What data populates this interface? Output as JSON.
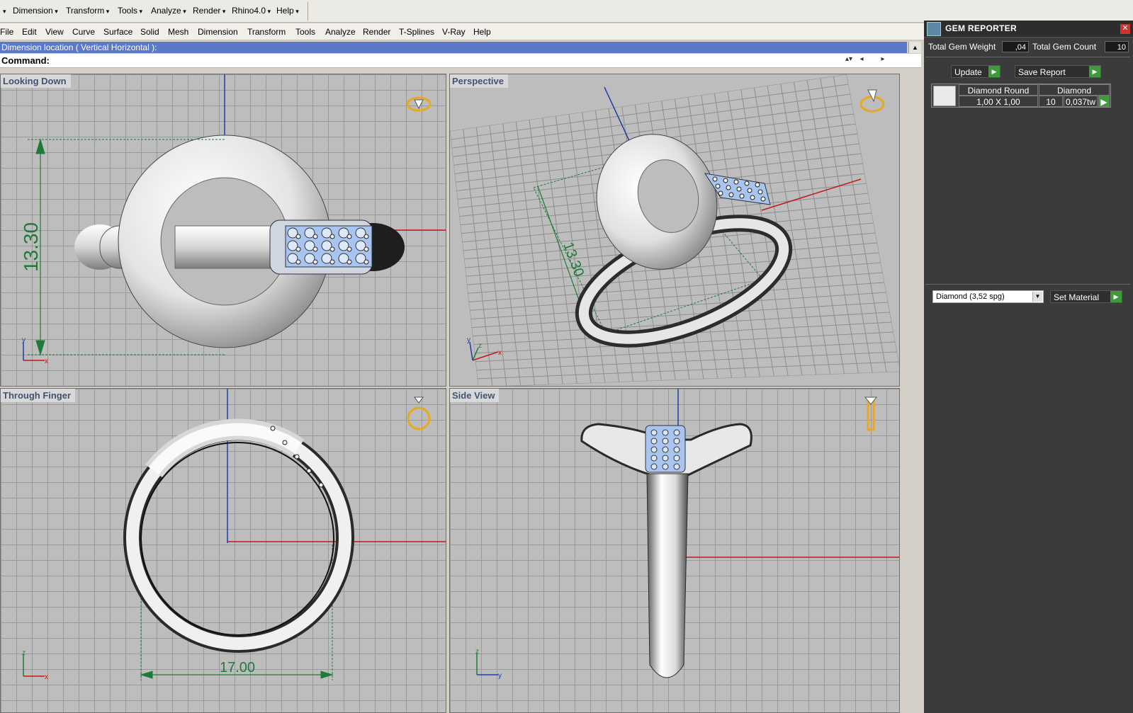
{
  "topbar": {
    "items": [
      "Dimension",
      "Transform",
      "Tools",
      "Analyze",
      "Render",
      "Rhino4.0",
      "Help"
    ]
  },
  "menubar": {
    "items": [
      "File",
      "Edit",
      "View",
      "Curve",
      "Surface",
      "Solid",
      "Mesh",
      "Dimension",
      "Transform",
      "Tools",
      "Analyze",
      "Render",
      "T-Splines",
      "V-Ray",
      "Help"
    ]
  },
  "command_area": {
    "prompt": "Dimension location ( Vertical  Horizontal ):",
    "command_label": "Command:"
  },
  "viewports": {
    "top_left": {
      "title": "Looking Down",
      "dimension": "13.30"
    },
    "top_right": {
      "title": "Perspective",
      "dimension": "13.30"
    },
    "bottom_left": {
      "title": "Through Finger",
      "dimension": "17.00"
    },
    "bottom_right": {
      "title": "Side View"
    }
  },
  "axes": {
    "x": "x",
    "y": "y",
    "z": "z"
  },
  "gem_panel": {
    "title": "GEM REPORTER",
    "total_weight_label": "Total Gem Weight",
    "total_weight_value": ",04",
    "total_count_label": "Total Gem Count",
    "total_count_value": "10",
    "update_label": "Update",
    "save_label": "Save Report",
    "table": {
      "col1_header": "Diamond Round",
      "col2_header": "Diamond",
      "size": "1,00 X 1,00",
      "count": "10",
      "weight": "0,037tw"
    },
    "material_select": "Diamond    (3,52 spg)",
    "set_material_label": "Set Material"
  },
  "colors": {
    "prompt_bg": "#5b79c6",
    "panel_bg": "#3b3b3b",
    "dimension_green": "#1f7a3a",
    "axis_red": "#c01818",
    "axis_blue": "#1d3fa8",
    "gem_blue": "#a8c4f0"
  }
}
